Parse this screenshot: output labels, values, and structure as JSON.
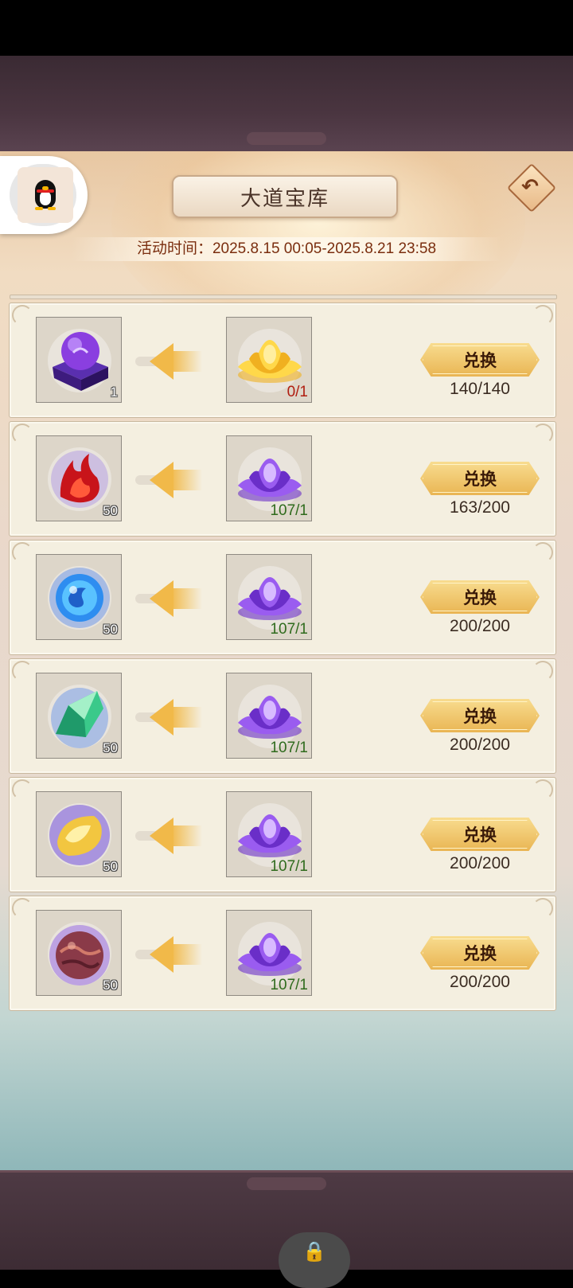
{
  "header": {
    "title": "大道宝库",
    "event_time": "活动时间：2025.8.15 00:05-2025.8.21 23:58"
  },
  "rows": [
    {
      "reward_icon": "purple-crystal-ball-icon",
      "reward_qty": "1",
      "cost_icon": "golden-lotus-icon",
      "cost_progress": "0/1",
      "cost_status": "insufficient",
      "button_label": "兑换",
      "stock": "140/140"
    },
    {
      "reward_icon": "red-flame-orb-icon",
      "reward_qty": "50",
      "cost_icon": "purple-lotus-icon",
      "cost_progress": "107/1",
      "cost_status": "sufficient",
      "button_label": "兑换",
      "stock": "163/200"
    },
    {
      "reward_icon": "blue-water-orb-icon",
      "reward_qty": "50",
      "cost_icon": "purple-lotus-icon",
      "cost_progress": "107/1",
      "cost_status": "sufficient",
      "button_label": "兑换",
      "stock": "200/200"
    },
    {
      "reward_icon": "green-crystal-shard-icon",
      "reward_qty": "50",
      "cost_icon": "purple-lotus-icon",
      "cost_progress": "107/1",
      "cost_status": "sufficient",
      "button_label": "兑换",
      "stock": "200/200"
    },
    {
      "reward_icon": "golden-scroll-orb-icon",
      "reward_qty": "50",
      "cost_icon": "purple-lotus-icon",
      "cost_progress": "107/1",
      "cost_status": "sufficient",
      "button_label": "兑换",
      "stock": "200/200"
    },
    {
      "reward_icon": "dark-earth-orb-icon",
      "reward_qty": "50",
      "cost_icon": "purple-lotus-icon",
      "cost_progress": "107/1",
      "cost_status": "sufficient",
      "button_label": "兑换",
      "stock": "200/200"
    }
  ],
  "colors": {
    "insufficient": "#b01d10",
    "sufficient": "#2f6b1d",
    "button_gold": "#e9b553",
    "title_text": "#4a3328",
    "event_time_text": "#7a2d0e"
  }
}
